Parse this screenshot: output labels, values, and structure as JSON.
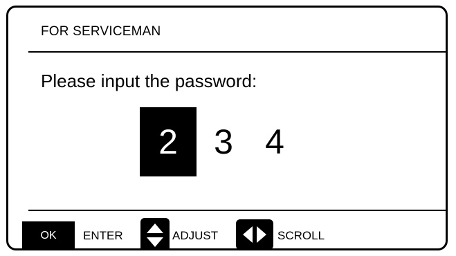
{
  "header": {
    "title": "FOR SERVICEMAN"
  },
  "main": {
    "prompt": "Please input the password:",
    "password_digits": [
      {
        "value": "2",
        "selected": true
      },
      {
        "value": "3",
        "selected": false
      },
      {
        "value": "4",
        "selected": false
      }
    ]
  },
  "footer": {
    "ok_key": "OK",
    "enter_label": "ENTER",
    "adjust_icon": "up-down-arrows-icon",
    "adjust_label": "ADJUST",
    "scroll_icon": "left-right-arrows-icon",
    "scroll_label": "SCROLL"
  },
  "colors": {
    "foreground": "#000000",
    "background": "#ffffff"
  }
}
